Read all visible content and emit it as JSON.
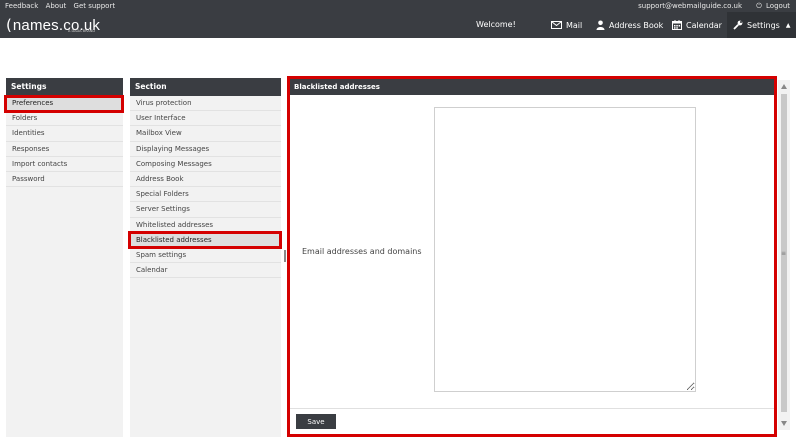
{
  "topbar": {
    "links": [
      "Feedback",
      "About",
      "Get support"
    ],
    "email": "support@webmailguide.co.uk",
    "logout": "Logout"
  },
  "header": {
    "logo_text": "names.co.uk",
    "logo_sub": "A DADA BRAND",
    "welcome": "Welcome!",
    "nav": {
      "mail": "Mail",
      "address_book": "Address Book",
      "calendar": "Calendar",
      "settings": "Settings"
    }
  },
  "settings_panel": {
    "title": "Settings",
    "items": [
      "Preferences",
      "Folders",
      "Identities",
      "Responses",
      "Import contacts",
      "Password"
    ]
  },
  "section_panel": {
    "title": "Section",
    "items": [
      "Virus protection",
      "User Interface",
      "Mailbox View",
      "Displaying Messages",
      "Composing Messages",
      "Address Book",
      "Special Folders",
      "Server Settings",
      "Whitelisted addresses",
      "Blacklisted addresses",
      "Spam settings",
      "Calendar"
    ]
  },
  "content": {
    "title": "Blacklisted addresses",
    "field_label": "Email addresses and domains",
    "textarea_value": "",
    "save_label": "Save"
  },
  "colors": {
    "header_bg": "#3a3d42",
    "highlight": "#d40000"
  }
}
